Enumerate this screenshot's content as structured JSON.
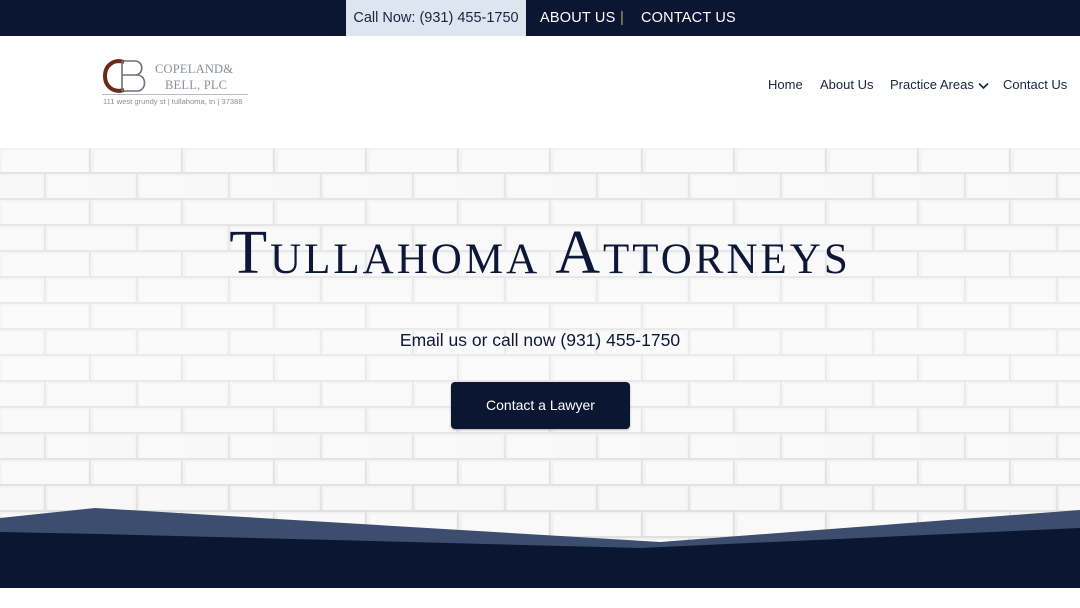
{
  "topbar": {
    "call_now": "Call Now: (931) 455-1750",
    "about": "ABOUT US",
    "separator": "|",
    "contact": "CONTACT US"
  },
  "logo": {
    "monogram": "CB",
    "name_line1": "COPELAND&",
    "name_line2": "BELL, PLC",
    "address": "111 west grundy st | tullahoma, tn | 37388"
  },
  "nav": {
    "home": "Home",
    "about": "About Us",
    "practice": "Practice Areas",
    "contact": "Contact Us"
  },
  "hero": {
    "title": "Tullahoma Attorneys",
    "subtitle": "Email us or call now (931) 455-1750",
    "cta": "Contact a Lawyer"
  },
  "colors": {
    "navy": "#0a1632",
    "pill": "#dde6ef",
    "separator_gold": "#c49a55",
    "wave_slate": "#3d4d6e",
    "logo_brown": "#6b2a17"
  },
  "icons": {
    "practice_dropdown": "chevron-down-icon"
  }
}
